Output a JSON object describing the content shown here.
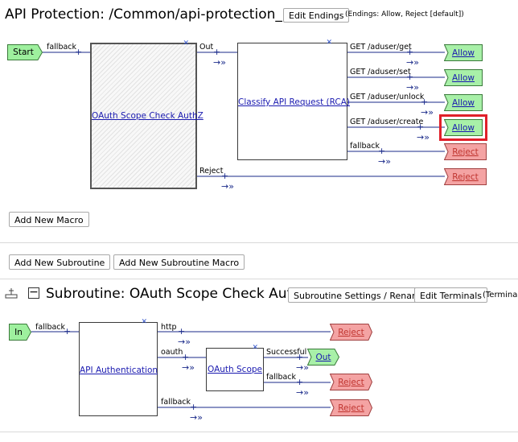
{
  "header": {
    "title": "API Protection: /Common/api-protection_prp",
    "edit_endings_label": "Edit Endings",
    "endings_note": "(Endings: Allow, Reject [default])"
  },
  "main_flow": {
    "start_label": "Start",
    "start_branch": "fallback",
    "macro_box_label": "OAuth Scope Check AuthZ",
    "macro_out_branch": "Out",
    "macro_reject_branch": "Reject",
    "rca_box_label": "Classify API Request (RCA)",
    "rca_branches": [
      {
        "label": "GET /aduser/get",
        "ending": "Allow"
      },
      {
        "label": "GET /aduser/set",
        "ending": "Allow"
      },
      {
        "label": "GET /aduser/unlock",
        "ending": "Allow"
      },
      {
        "label": "GET /aduser/create",
        "ending": "Allow"
      },
      {
        "label": "fallback",
        "ending": "Reject"
      }
    ],
    "reject_ending": "Reject"
  },
  "buttons": {
    "add_macro": "Add New Macro",
    "add_subroutine": "Add New Subroutine",
    "add_subroutine_macro": "Add New Subroutine Macro"
  },
  "subroutine": {
    "title": "Subroutine: OAuth Scope Check AuthZ",
    "settings_label": "Subroutine Settings / Rename",
    "edit_terminals_label": "Edit Terminals",
    "terminals_note": "(Terminals",
    "in_label": "In",
    "in_branch": "fallback",
    "auth_box_label": "API Authentication",
    "auth_branches": [
      "http",
      "oauth",
      "fallback"
    ],
    "http_ending": "Reject",
    "fallback_ending": "Reject",
    "scope_box_label": "OAuth Scope",
    "scope_branches": [
      "Successful",
      "fallback"
    ],
    "successful_ending": "Out",
    "scope_fallback_ending": "Reject"
  },
  "colors": {
    "allow_fill": "#a8f0a8",
    "reject_fill": "#f4a3a3",
    "start_fill": "#9ef09e",
    "link": "#1a1ab0",
    "highlight": "#e0202a"
  }
}
